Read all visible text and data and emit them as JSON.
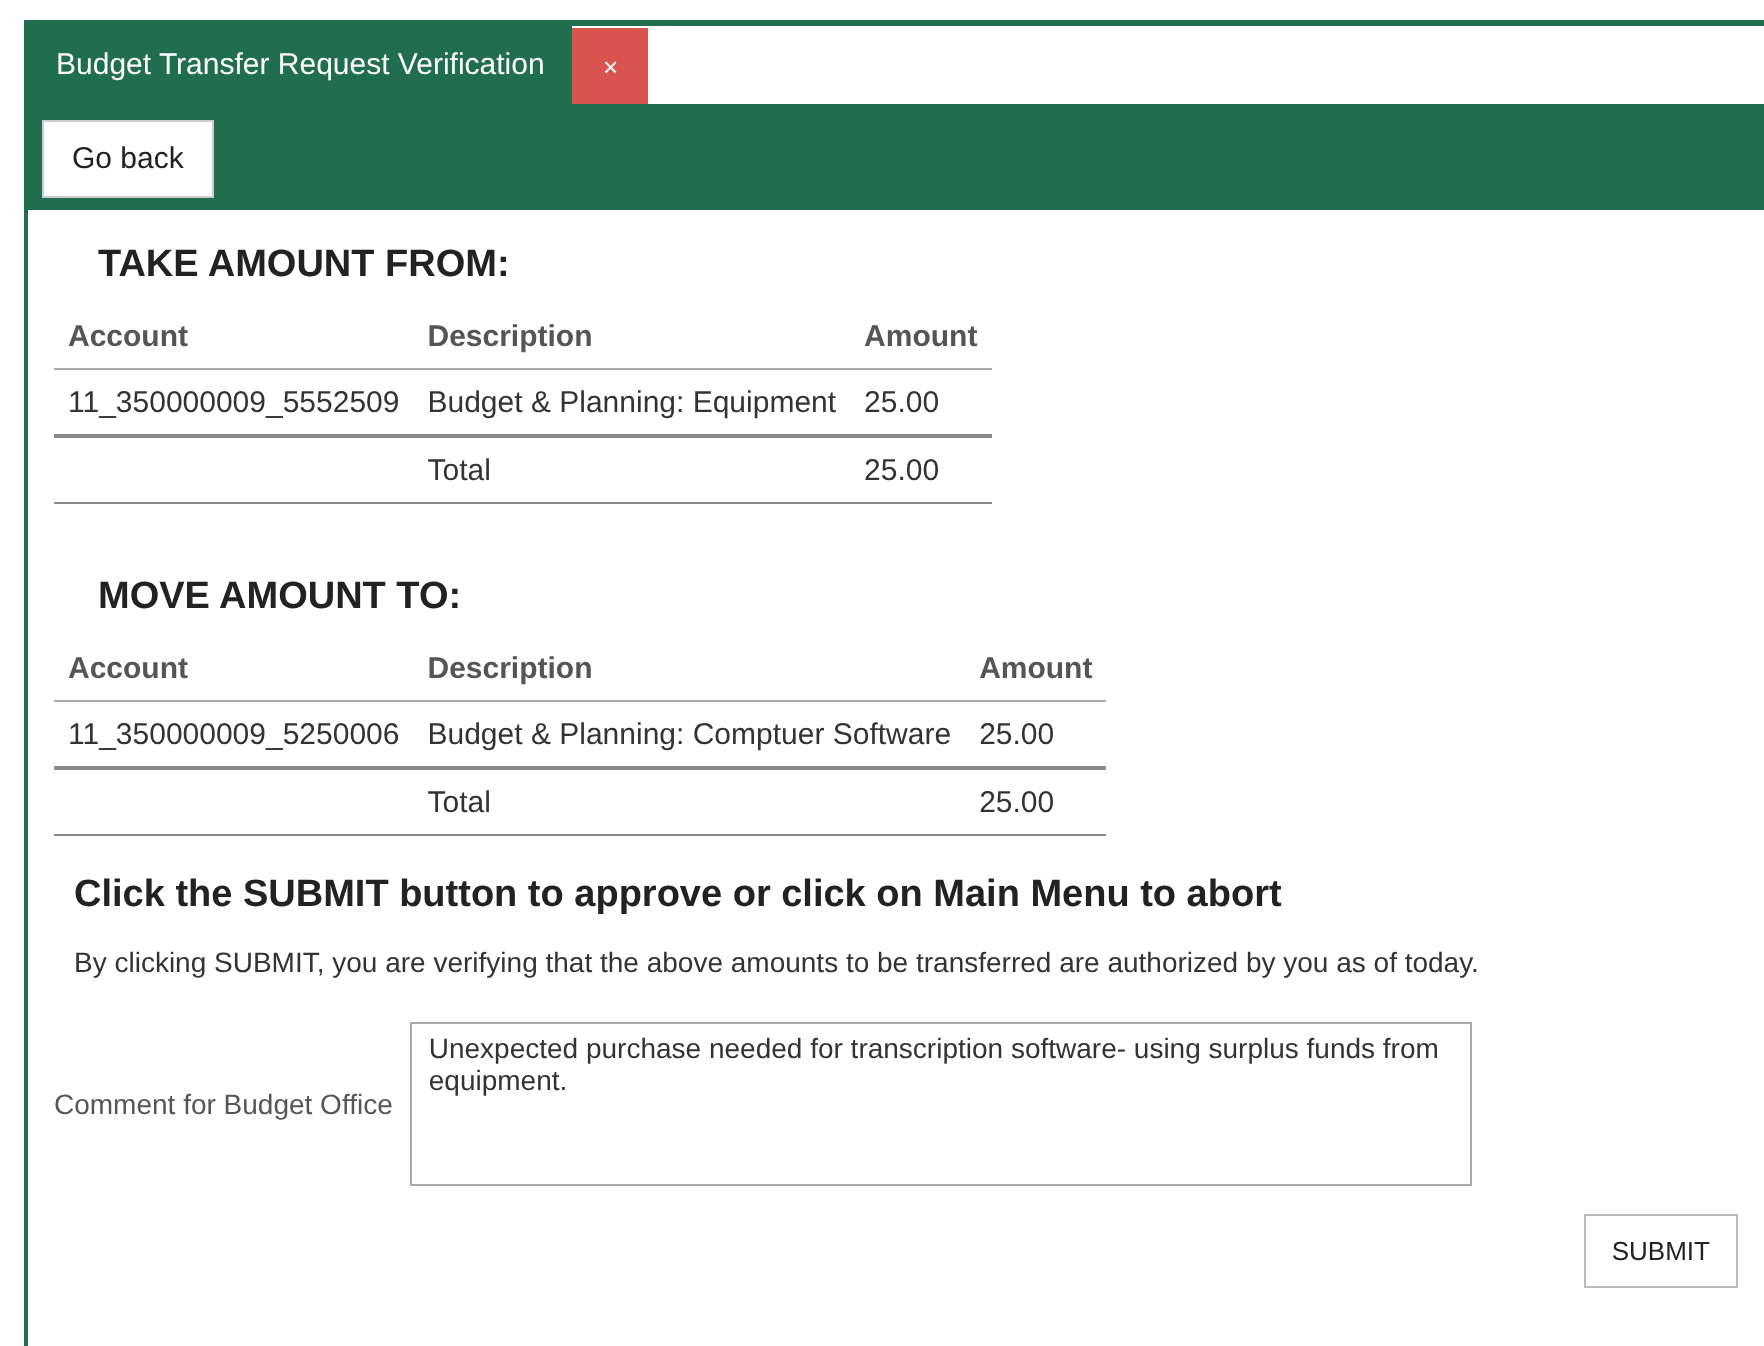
{
  "tab": {
    "title": "Budget Transfer Request Verification",
    "close": "×",
    "selected": true
  },
  "toolbar": {
    "back_button": "Go back"
  },
  "sections": [
    {
      "heading": "TAKE AMOUNT FROM:",
      "columns": [
        "Account",
        "Description",
        "Amount"
      ],
      "rows": [
        [
          "11_350000009_5552509",
          "Budget & Planning: Equipment",
          "25.00"
        ]
      ],
      "total": {
        "label": "Total",
        "amount": "25.00"
      }
    },
    {
      "heading": "MOVE AMOUNT TO:",
      "columns": [
        "Account",
        "Description",
        "Amount"
      ],
      "rows": [
        [
          "11_350000009_5250006",
          "Budget & Planning: Comptuer Software",
          "25.00"
        ]
      ],
      "total": {
        "label": "Total",
        "amount": "25.00"
      }
    }
  ],
  "instruction": "Click the SUBMIT button to approve or click on Main Menu to abort",
  "notice": "By clicking SUBMIT, you are verifying that the above amounts to be transferred are authorized by you as of today.",
  "comment": {
    "label": "Comment for Budget Office",
    "value": "Unexpected purchase needed for transcription software- using surplus funds from equipment."
  },
  "submit_button": "SUBMIT"
}
